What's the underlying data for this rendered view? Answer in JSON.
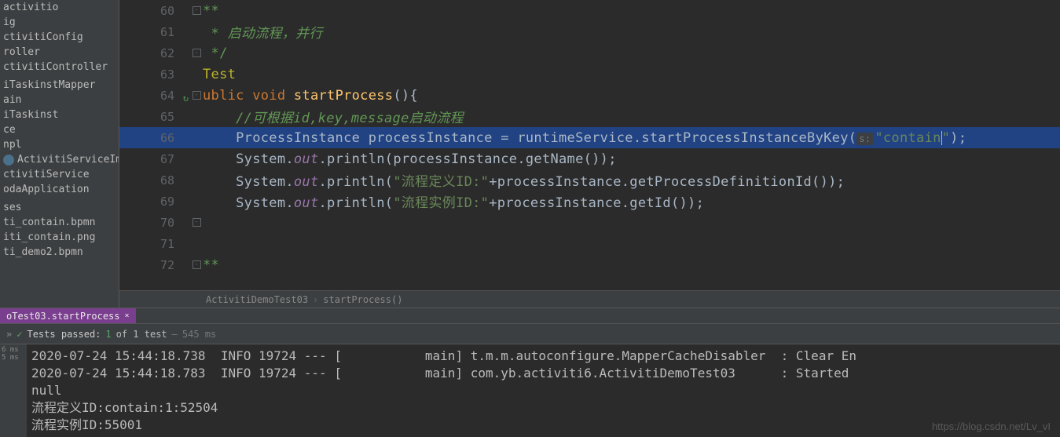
{
  "sidebar": {
    "items": [
      {
        "label": "activitio"
      },
      {
        "label": "ig"
      },
      {
        "label": "ctivitiConfig"
      },
      {
        "label": "roller"
      },
      {
        "label": "ctivitiController"
      },
      {
        "label": ""
      },
      {
        "label": "iTaskinstMapper"
      },
      {
        "label": "ain"
      },
      {
        "label": "iTaskinst"
      },
      {
        "label": "ce"
      },
      {
        "label": "npl"
      },
      {
        "label": "ActivitiServiceImpl",
        "selected": true
      },
      {
        "label": "ctivitiService"
      },
      {
        "label": "odaApplication"
      },
      {
        "label": ""
      },
      {
        "label": "ses"
      },
      {
        "label": "ti_contain.bpmn"
      },
      {
        "label": "iti_contain.png"
      },
      {
        "label": "ti_demo2.bpmn"
      }
    ]
  },
  "code": {
    "lines": [
      {
        "n": 60,
        "fold": "⊟",
        "tokens": [
          {
            "c": "cmt-star",
            "t": "**"
          }
        ]
      },
      {
        "n": 61,
        "fold": "",
        "tokens": [
          {
            "c": "cmt",
            "t": " * 启动流程，并行"
          }
        ]
      },
      {
        "n": 62,
        "fold": "⊟",
        "tokens": [
          {
            "c": "cmt-star",
            "t": " */"
          }
        ]
      },
      {
        "n": 63,
        "fold": "",
        "tokens": [
          {
            "c": "ann",
            "t": "Test"
          }
        ],
        "indent_raw": true
      },
      {
        "n": 64,
        "fold": "⊟",
        "vcs": true,
        "tokens": [
          {
            "c": "kw",
            "t": "ublic void "
          },
          {
            "c": "mtd",
            "t": "startProcess"
          },
          {
            "c": "",
            "t": "(){"
          }
        ],
        "indent_raw": true
      },
      {
        "n": 65,
        "fold": "",
        "tokens": [
          {
            "c": "",
            "t": "    "
          },
          {
            "c": "cmt",
            "t": "//可根据id,key,message启动流程"
          }
        ]
      },
      {
        "n": 66,
        "hl": true,
        "fold": "",
        "tokens": [
          {
            "c": "",
            "t": "    ProcessInstance processInstance = "
          },
          {
            "c": "call",
            "t": "runtimeService"
          },
          {
            "c": "",
            "t": ".startProcessInstanceByKey("
          },
          {
            "c": "hint",
            "t": "s:"
          },
          {
            "c": "str",
            "t": "\"contain"
          },
          {
            "cursor": true
          },
          {
            "c": "str",
            "t": "\""
          },
          {
            "c": "",
            "t": ");"
          }
        ]
      },
      {
        "n": 67,
        "fold": "",
        "tokens": [
          {
            "c": "",
            "t": "    System."
          },
          {
            "c": "field",
            "t": "out"
          },
          {
            "c": "",
            "t": ".println(processInstance.getName());"
          }
        ]
      },
      {
        "n": 68,
        "fold": "",
        "tokens": [
          {
            "c": "",
            "t": "    System."
          },
          {
            "c": "field",
            "t": "out"
          },
          {
            "c": "",
            "t": ".println("
          },
          {
            "c": "str",
            "t": "\"流程定义ID:\""
          },
          {
            "c": "",
            "t": "+processInstance.getProcessDefinitionId());"
          }
        ]
      },
      {
        "n": 69,
        "fold": "",
        "tokens": [
          {
            "c": "",
            "t": "    System."
          },
          {
            "c": "field",
            "t": "out"
          },
          {
            "c": "",
            "t": ".println("
          },
          {
            "c": "str",
            "t": "\"流程实例ID:\""
          },
          {
            "c": "",
            "t": "+processInstance.getId());"
          }
        ]
      },
      {
        "n": 70,
        "fold": "⊟",
        "tokens": []
      },
      {
        "n": 71,
        "fold": "",
        "tokens": []
      },
      {
        "n": 72,
        "fold": "⊟",
        "tokens": [
          {
            "c": "cmt-star",
            "t": "**"
          }
        ]
      }
    ]
  },
  "breadcrumb": {
    "cls": "ActivitiDemoTest03",
    "mtd": "startProcess()"
  },
  "run_tab": {
    "label": "oTest03.startProcess",
    "close": "×"
  },
  "status": {
    "chev": "»",
    "check": "✓",
    "label": "Tests passed:",
    "count": "1",
    "of": "of 1 test",
    "dash": "–",
    "time": "545 ms"
  },
  "console_left": [
    "6 ms",
    "5 ms"
  ],
  "console": [
    "2020-07-24 15:44:18.738  INFO 19724 --- [           main] t.m.m.autoconfigure.MapperCacheDisabler  : Clear En",
    "2020-07-24 15:44:18.783  INFO 19724 --- [           main] com.yb.activiti6.ActivitiDemoTest03      : Started ",
    "null",
    "流程定义ID:contain:1:52504",
    "流程实例ID:55001"
  ],
  "watermark": "https://blog.csdn.net/Lv_vI"
}
